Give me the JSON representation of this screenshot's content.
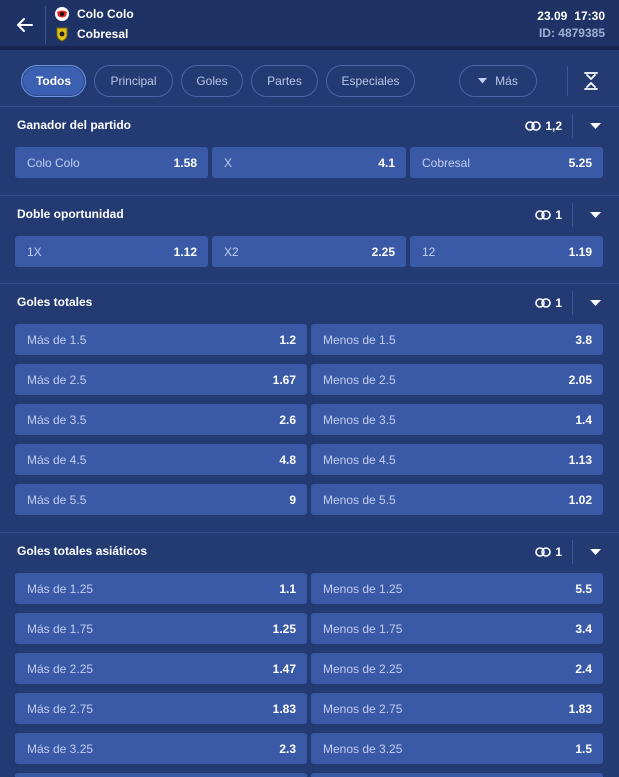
{
  "header": {
    "home_team": "Colo Colo",
    "away_team": "Cobresal",
    "date": "23.09",
    "time": "17:30",
    "match_id": "ID: 4879385"
  },
  "tabs": [
    {
      "label": "Todos",
      "active": true
    },
    {
      "label": "Principal"
    },
    {
      "label": "Goles"
    },
    {
      "label": "Partes"
    },
    {
      "label": "Especiales"
    },
    {
      "label": "Más"
    }
  ],
  "markets": [
    {
      "title": "Ganador del partido",
      "count": "1,2",
      "rows": [
        [
          {
            "label": "Colo Colo",
            "odd": "1.58"
          },
          {
            "label": "X",
            "odd": "4.1"
          },
          {
            "label": "Cobresal",
            "odd": "5.25"
          }
        ]
      ]
    },
    {
      "title": "Doble oportunidad",
      "count": "1",
      "rows": [
        [
          {
            "label": "1X",
            "odd": "1.12"
          },
          {
            "label": "X2",
            "odd": "2.25"
          },
          {
            "label": "12",
            "odd": "1.19"
          }
        ]
      ]
    },
    {
      "title": "Goles totales",
      "count": "1",
      "rows": [
        [
          {
            "label": "Más de 1.5",
            "odd": "1.2"
          },
          {
            "label": "Menos de 1.5",
            "odd": "3.8"
          }
        ],
        [
          {
            "label": "Más de 2.5",
            "odd": "1.67"
          },
          {
            "label": "Menos de 2.5",
            "odd": "2.05"
          }
        ],
        [
          {
            "label": "Más de 3.5",
            "odd": "2.6"
          },
          {
            "label": "Menos de 3.5",
            "odd": "1.4"
          }
        ],
        [
          {
            "label": "Más de 4.5",
            "odd": "4.8"
          },
          {
            "label": "Menos de 4.5",
            "odd": "1.13"
          }
        ],
        [
          {
            "label": "Más de 5.5",
            "odd": "9"
          },
          {
            "label": "Menos de 5.5",
            "odd": "1.02"
          }
        ]
      ]
    },
    {
      "title": "Goles totales asiáticos",
      "count": "1",
      "rows": [
        [
          {
            "label": "Más de 1.25",
            "odd": "1.1"
          },
          {
            "label": "Menos de 1.25",
            "odd": "5.5"
          }
        ],
        [
          {
            "label": "Más de 1.75",
            "odd": "1.25"
          },
          {
            "label": "Menos de 1.75",
            "odd": "3.4"
          }
        ],
        [
          {
            "label": "Más de 2.25",
            "odd": "1.47"
          },
          {
            "label": "Menos de 2.25",
            "odd": "2.4"
          }
        ],
        [
          {
            "label": "Más de 2.75",
            "odd": "1.83"
          },
          {
            "label": "Menos de 2.75",
            "odd": "1.83"
          }
        ],
        [
          {
            "label": "Más de 3.25",
            "odd": "2.3"
          },
          {
            "label": "Menos de 3.25",
            "odd": "1.5"
          }
        ],
        [
          {
            "label": "",
            "odd": ""
          },
          {
            "label": "",
            "odd": ""
          }
        ]
      ]
    }
  ],
  "colors": {
    "background": "#233a73",
    "header": "#1e3266",
    "odd_button": "#3a5aa7",
    "active_tab": "#3b5fb1"
  },
  "icons": {
    "back": "arrow-left-icon",
    "link": "link-icon",
    "chevron": "chevron-down-icon",
    "collapse": "collapse-vertical-icon",
    "caret": "caret-down-icon"
  }
}
